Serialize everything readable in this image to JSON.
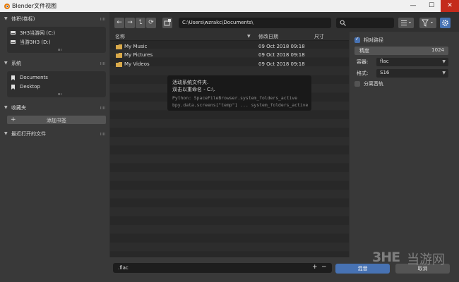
{
  "window": {
    "title": "Blender文件视图",
    "min_glyph": "—",
    "max_glyph": "☐",
    "close_glyph": "✕"
  },
  "sidebar": {
    "volumes": {
      "header": "体积(卷标)",
      "items": [
        {
          "label": "3H3当游网 (C:)",
          "icon": "drive-icon"
        },
        {
          "label": "当游3H3 (D:)",
          "icon": "drive-icon"
        }
      ]
    },
    "system": {
      "header": "系统",
      "items": [
        {
          "label": "Documents",
          "icon": "bookmark-icon"
        },
        {
          "label": "Desktop",
          "icon": "bookmark-icon"
        }
      ]
    },
    "bookmarks": {
      "header": "收藏夹",
      "add_label": "添加书签"
    },
    "recent": {
      "header": "最近打开的文件"
    }
  },
  "toolbar": {
    "back_icon": "←",
    "forward_icon": "→",
    "parent_icon": "⮤",
    "refresh_icon": "⟳",
    "path": "C:\\Users\\wzrakc\\Documents\\"
  },
  "file_list": {
    "columns": {
      "name": "名称",
      "date": "修改日期",
      "size": "尺寸"
    },
    "rows": [
      {
        "name": "My Music",
        "date": "09 Oct 2018 09:18"
      },
      {
        "name": "My Pictures",
        "date": "09 Oct 2018 09:18"
      },
      {
        "name": "My Videos",
        "date": "09 Oct 2018 09:18"
      }
    ]
  },
  "tooltip": {
    "line1": "活动系统文件夹.",
    "line2": "双击以重命名 - C:\\.",
    "python1": "Python: SpaceFileBrowser.system_folders_active",
    "python2": "bpy.data.screens[\"temp\"] ... system_folders_active"
  },
  "options": {
    "relative_path_label": "相对路径",
    "relative_path_checked": true,
    "precision_label": "精度",
    "precision_value": "1024",
    "container_label": "容器:",
    "container_value": "flac",
    "format_label": "格式:",
    "format_value": "S16",
    "split_channels_label": "分离音轨",
    "split_channels_checked": false
  },
  "bottom": {
    "filename": ".flac",
    "plus": "+",
    "minus": "−",
    "confirm_label": "混音",
    "cancel_label": "取消"
  },
  "watermark": {
    "brand": "3HE",
    "text": "当游网"
  },
  "colors": {
    "accent": "#4772b3",
    "panel": "#393939",
    "folder": "#d9a94a"
  }
}
